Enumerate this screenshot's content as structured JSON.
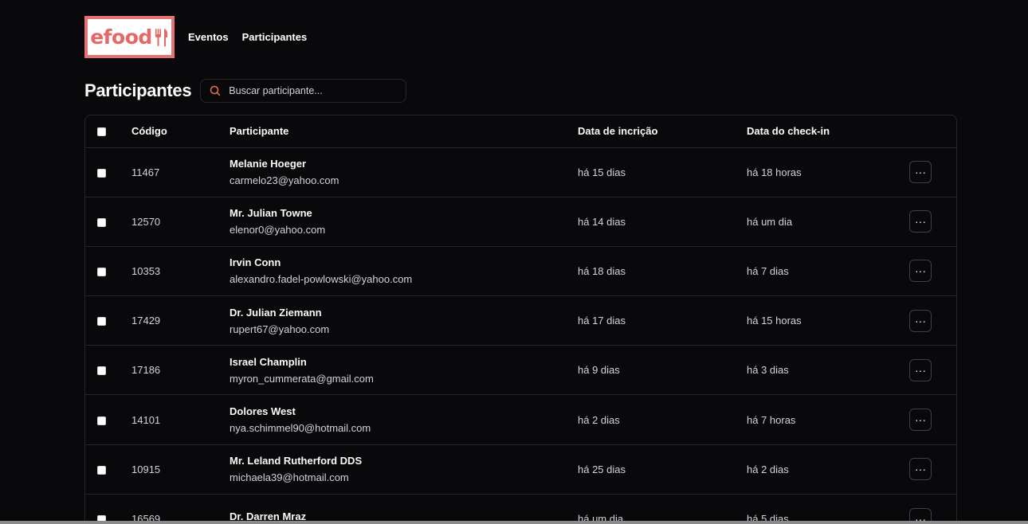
{
  "brand": {
    "logo_text": "efood",
    "accent": "#e66767"
  },
  "nav": {
    "items": [
      "Eventos",
      "Participantes"
    ]
  },
  "page": {
    "title": "Participantes"
  },
  "search": {
    "placeholder": "Buscar participante...",
    "value": ""
  },
  "table": {
    "headers": {
      "code": "Código",
      "participant": "Participante",
      "registered": "Data de incrição",
      "checkin": "Data do check-in"
    },
    "rows": [
      {
        "code": "11467",
        "name": "Melanie Hoeger",
        "email": "carmelo23@yahoo.com",
        "registered": "há 15 dias",
        "checkin": "há 18 horas"
      },
      {
        "code": "12570",
        "name": "Mr. Julian Towne",
        "email": "elenor0@yahoo.com",
        "registered": "há 14 dias",
        "checkin": "há um dia"
      },
      {
        "code": "10353",
        "name": "Irvin Conn",
        "email": "alexandro.fadel-powlowski@yahoo.com",
        "registered": "há 18 dias",
        "checkin": "há 7 dias"
      },
      {
        "code": "17429",
        "name": "Dr. Julian Ziemann",
        "email": "rupert67@yahoo.com",
        "registered": "há 17 dias",
        "checkin": "há 15 horas"
      },
      {
        "code": "17186",
        "name": "Israel Champlin",
        "email": "myron_cummerata@gmail.com",
        "registered": "há 9 dias",
        "checkin": "há 3 dias"
      },
      {
        "code": "14101",
        "name": "Dolores West",
        "email": "nya.schimmel90@hotmail.com",
        "registered": "há 2 dias",
        "checkin": "há 7 horas"
      },
      {
        "code": "10915",
        "name": "Mr. Leland Rutherford DDS",
        "email": "michaela39@hotmail.com",
        "registered": "há 25 dias",
        "checkin": "há 2 dias"
      },
      {
        "code": "16569",
        "name": "Dr. Darren Mraz",
        "email": "",
        "registered": "há um dia",
        "checkin": "há 5 dias"
      }
    ],
    "more_label": "···"
  }
}
